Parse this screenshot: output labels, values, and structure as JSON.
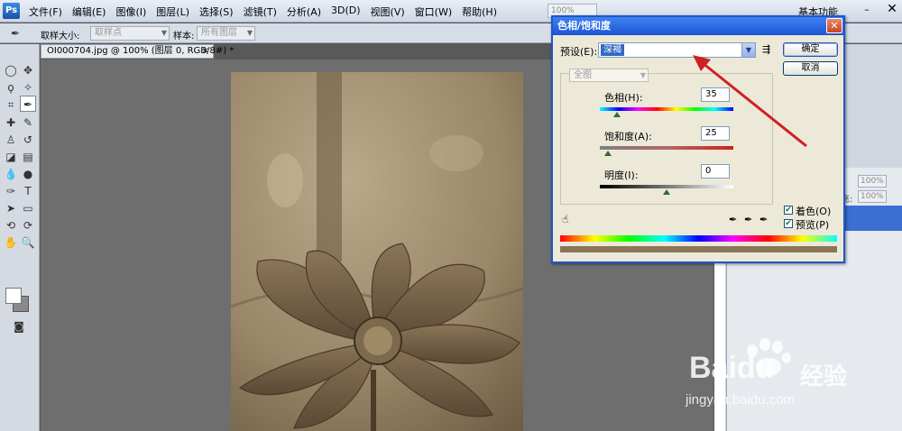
{
  "app": {
    "logo_text": "Ps",
    "menus": [
      "文件(F)",
      "编辑(E)",
      "图像(I)",
      "图层(L)",
      "选择(S)",
      "滤镜(T)",
      "分析(A)",
      "3D(D)",
      "视图(V)",
      "窗口(W)",
      "帮助(H)"
    ],
    "zoom_value": "100%",
    "workspace": "基本功能",
    "min_glyph": "–",
    "close_glyph": "✕"
  },
  "options": {
    "sample_size_label": "取样大小:",
    "sample_size_value": "取样点",
    "sample_label": "样本:",
    "sample_value": "所有图层"
  },
  "document": {
    "tab_title": "OI000704.jpg @ 100% (图层 0, RGB/8#) *",
    "tab_close": "×"
  },
  "panels": {
    "opacity_1": "100%",
    "opacity_2": "100%",
    "fill_label": "充:",
    "fill_value": "100%"
  },
  "dialog": {
    "title": "色相/饱和度",
    "close": "✕",
    "preset_label": "预设(E):",
    "preset_value": "深褐",
    "ok": "确定",
    "cancel": "取消",
    "channel": "全图",
    "hue_label": "色相(H):",
    "hue_value": "35",
    "hue_level": 35,
    "saturation_label": "饱和度(A):",
    "saturation_value": "25",
    "saturation_level": 25,
    "lightness_label": "明度(I):",
    "lightness_value": "0",
    "lightness_level": 0,
    "colorize_label": "着色(O)",
    "colorize_checked": true,
    "preview_label": "预览(P)",
    "preview_checked": true
  },
  "watermark": {
    "brand": "Baidu",
    "brand_cn": "经验",
    "url": "jingyan.baidu.com"
  },
  "colors": {
    "dialog_title": "#1b54d4",
    "arrow": "#cc2222",
    "selected_layer": "#3b6fd1",
    "sepia": "#9d8a6d"
  }
}
